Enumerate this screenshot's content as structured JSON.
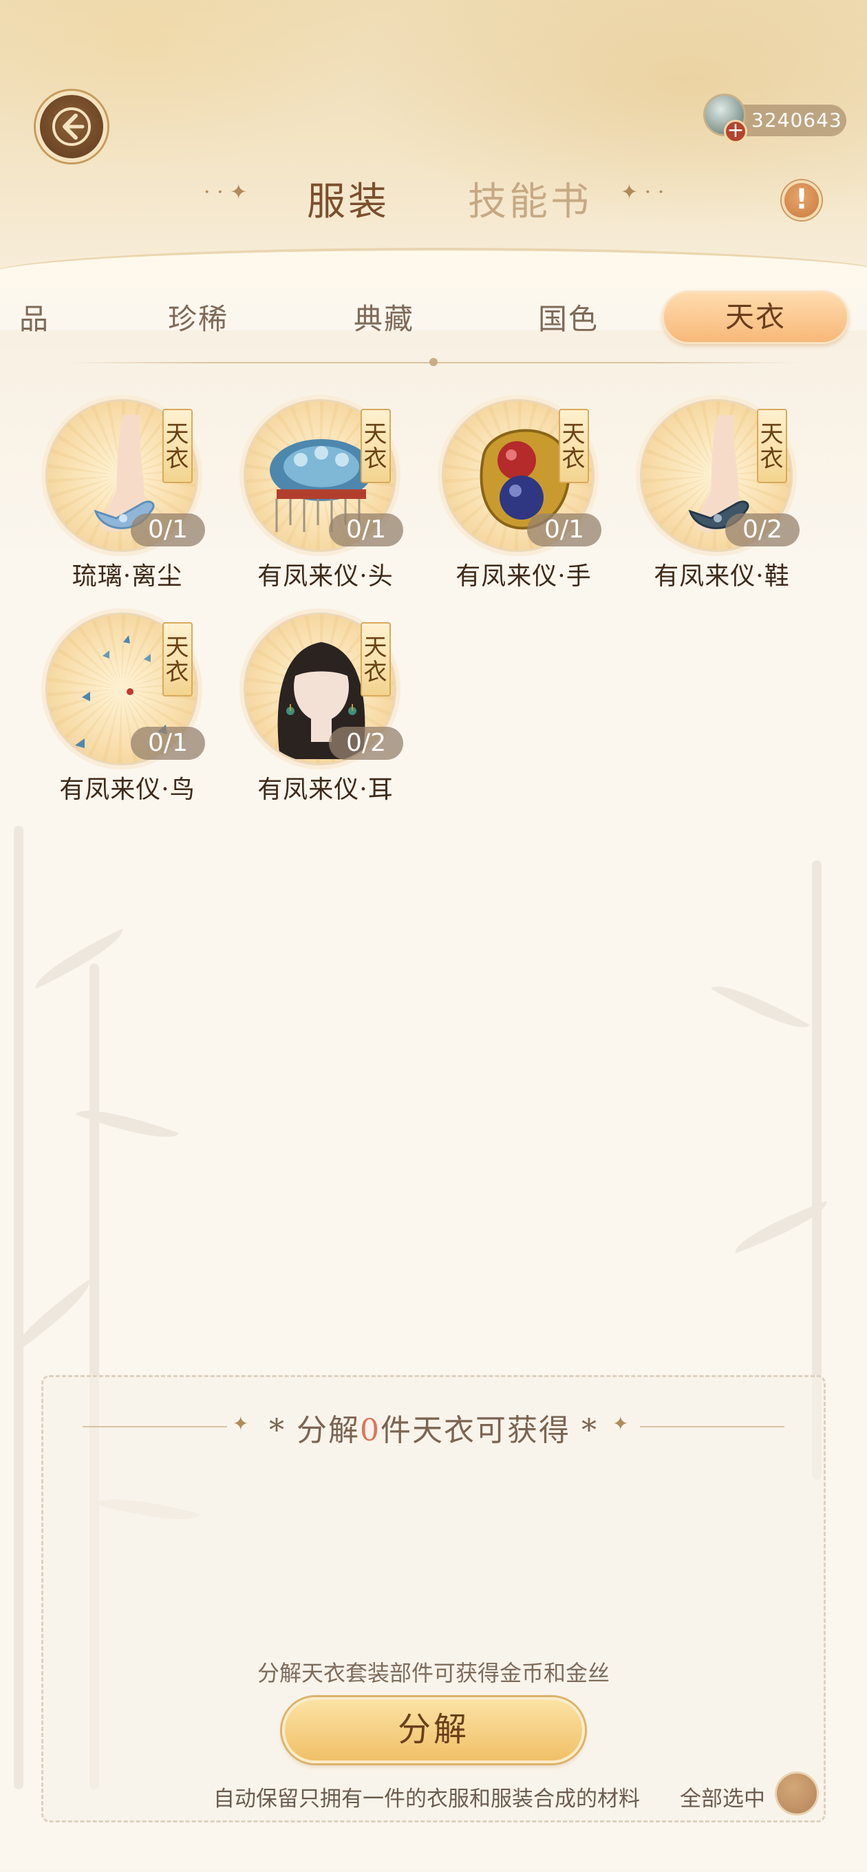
{
  "header": {
    "back_icon": "back-arrow-icon",
    "currency": {
      "icon": "jade-gem-icon",
      "plus_icon": "plus-icon",
      "amount": "3240643",
      "plus": "+"
    },
    "info_icon": "exclamation-icon",
    "info_symbol": "!"
  },
  "main_tabs": [
    {
      "label": "服装",
      "active": true
    },
    {
      "label": "技能书",
      "active": false
    }
  ],
  "sub_tabs": [
    {
      "label": "品",
      "active": false
    },
    {
      "label": "珍稀",
      "active": false
    },
    {
      "label": "典藏",
      "active": false
    },
    {
      "label": "国色",
      "active": false
    },
    {
      "label": "天衣",
      "active": true
    }
  ],
  "items": [
    {
      "name": "琉璃·离尘",
      "badge": "天衣",
      "count": "0/1",
      "art": "blue-shoe"
    },
    {
      "name": "有凤来仪·头",
      "badge": "天衣",
      "count": "0/1",
      "art": "phoenix-crown"
    },
    {
      "name": "有凤来仪·手",
      "badge": "天衣",
      "count": "0/1",
      "art": "gem-bracelet"
    },
    {
      "name": "有凤来仪·鞋",
      "badge": "天衣",
      "count": "0/2",
      "art": "dark-shoe"
    },
    {
      "name": "有凤来仪·鸟",
      "badge": "天衣",
      "count": "0/1",
      "art": "birds"
    },
    {
      "name": "有凤来仪·耳",
      "badge": "天衣",
      "count": "0/2",
      "art": "earrings-portrait"
    }
  ],
  "panel": {
    "title_prefix": "*  分解",
    "title_count": "0",
    "title_suffix": "件天衣可获得  *",
    "description": "分解天衣套装部件可获得金币和金丝",
    "decompose_label": "分解",
    "auto_keep": "自动保留只拥有一件的衣服和服装合成的材料",
    "select_all": "全部选中"
  },
  "colors": {
    "accent": "#f7b879",
    "count_highlight": "#e0725a",
    "text_dark": "#3e2a1a",
    "button_gold": "#f0c068"
  }
}
